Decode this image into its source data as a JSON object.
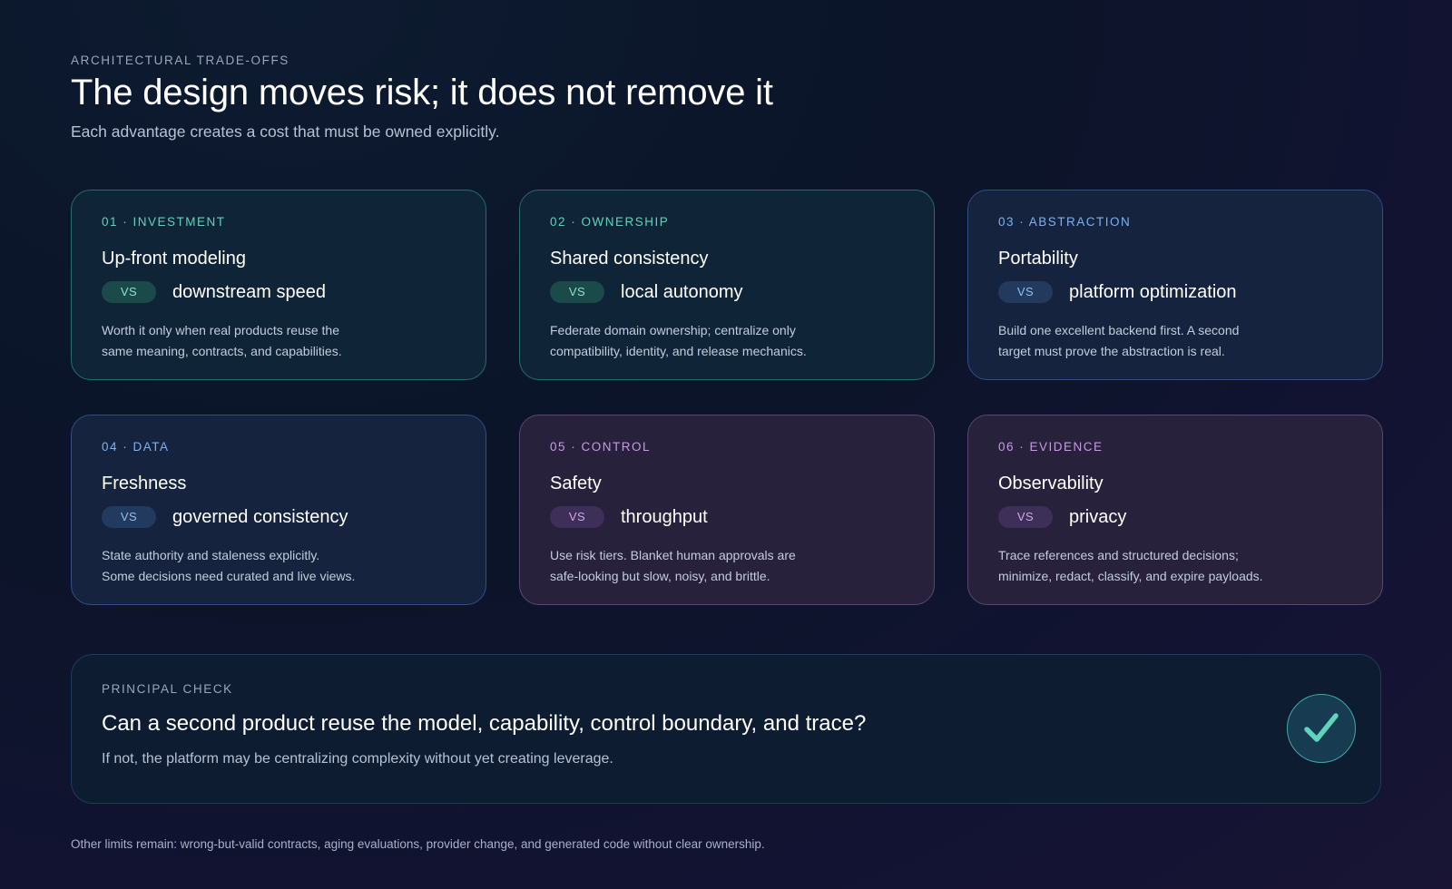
{
  "header": {
    "eyebrow": "ARCHITECTURAL TRADE-OFFS",
    "title": "The design moves risk; it does not remove it",
    "subtitle": "Each advantage creates a cost that must be owned explicitly."
  },
  "cards": [
    {
      "label": "01 · INVESTMENT",
      "title": "Up-front modeling",
      "vs_label": "VS",
      "counterpart": "downstream speed",
      "desc_line1": "Worth it only when real products reuse the",
      "desc_line2": "same meaning, contracts, and capabilities.",
      "accent": "#5fd3bc"
    },
    {
      "label": "02 · OWNERSHIP",
      "title": "Shared consistency",
      "vs_label": "VS",
      "counterpart": "local autonomy",
      "desc_line1": "Federate domain ownership; centralize only",
      "desc_line2": "compatibility, identity, and release mechanics.",
      "accent": "#5fd3bc"
    },
    {
      "label": "03 · ABSTRACTION",
      "title": "Portability",
      "vs_label": "VS",
      "counterpart": "platform optimization",
      "desc_line1": "Build one excellent backend first. A second",
      "desc_line2": "target must prove the abstraction is real.",
      "accent": "#7eb1f0"
    },
    {
      "label": "04 · DATA",
      "title": "Freshness",
      "vs_label": "VS",
      "counterpart": "governed consistency",
      "desc_line1": "State authority and staleness explicitly.",
      "desc_line2": "Some decisions need curated and live views.",
      "accent": "#7eb1f0"
    },
    {
      "label": "05 · CONTROL",
      "title": "Safety",
      "vs_label": "VS",
      "counterpart": "throughput",
      "desc_line1": "Use risk tiers. Blanket human approvals are",
      "desc_line2": "safe-looking but slow, noisy, and brittle.",
      "accent": "#c79ae6"
    },
    {
      "label": "06 · EVIDENCE",
      "title": "Observability",
      "vs_label": "VS",
      "counterpart": "privacy",
      "desc_line1": "Trace references and structured decisions;",
      "desc_line2": "minimize, redact, classify, and expire payloads.",
      "accent": "#c79ae6"
    }
  ],
  "principal": {
    "label": "PRINCIPAL CHECK",
    "question": "Can a second product reuse the model, capability, control boundary, and trace?",
    "note": "If not, the platform may be centralizing complexity without yet creating leverage.",
    "icon": "check-icon",
    "icon_color": "#5fd3bc"
  },
  "footer": {
    "text": "Other limits remain: wrong-but-valid contracts, aging evaluations, provider change, and generated code without clear ownership."
  }
}
